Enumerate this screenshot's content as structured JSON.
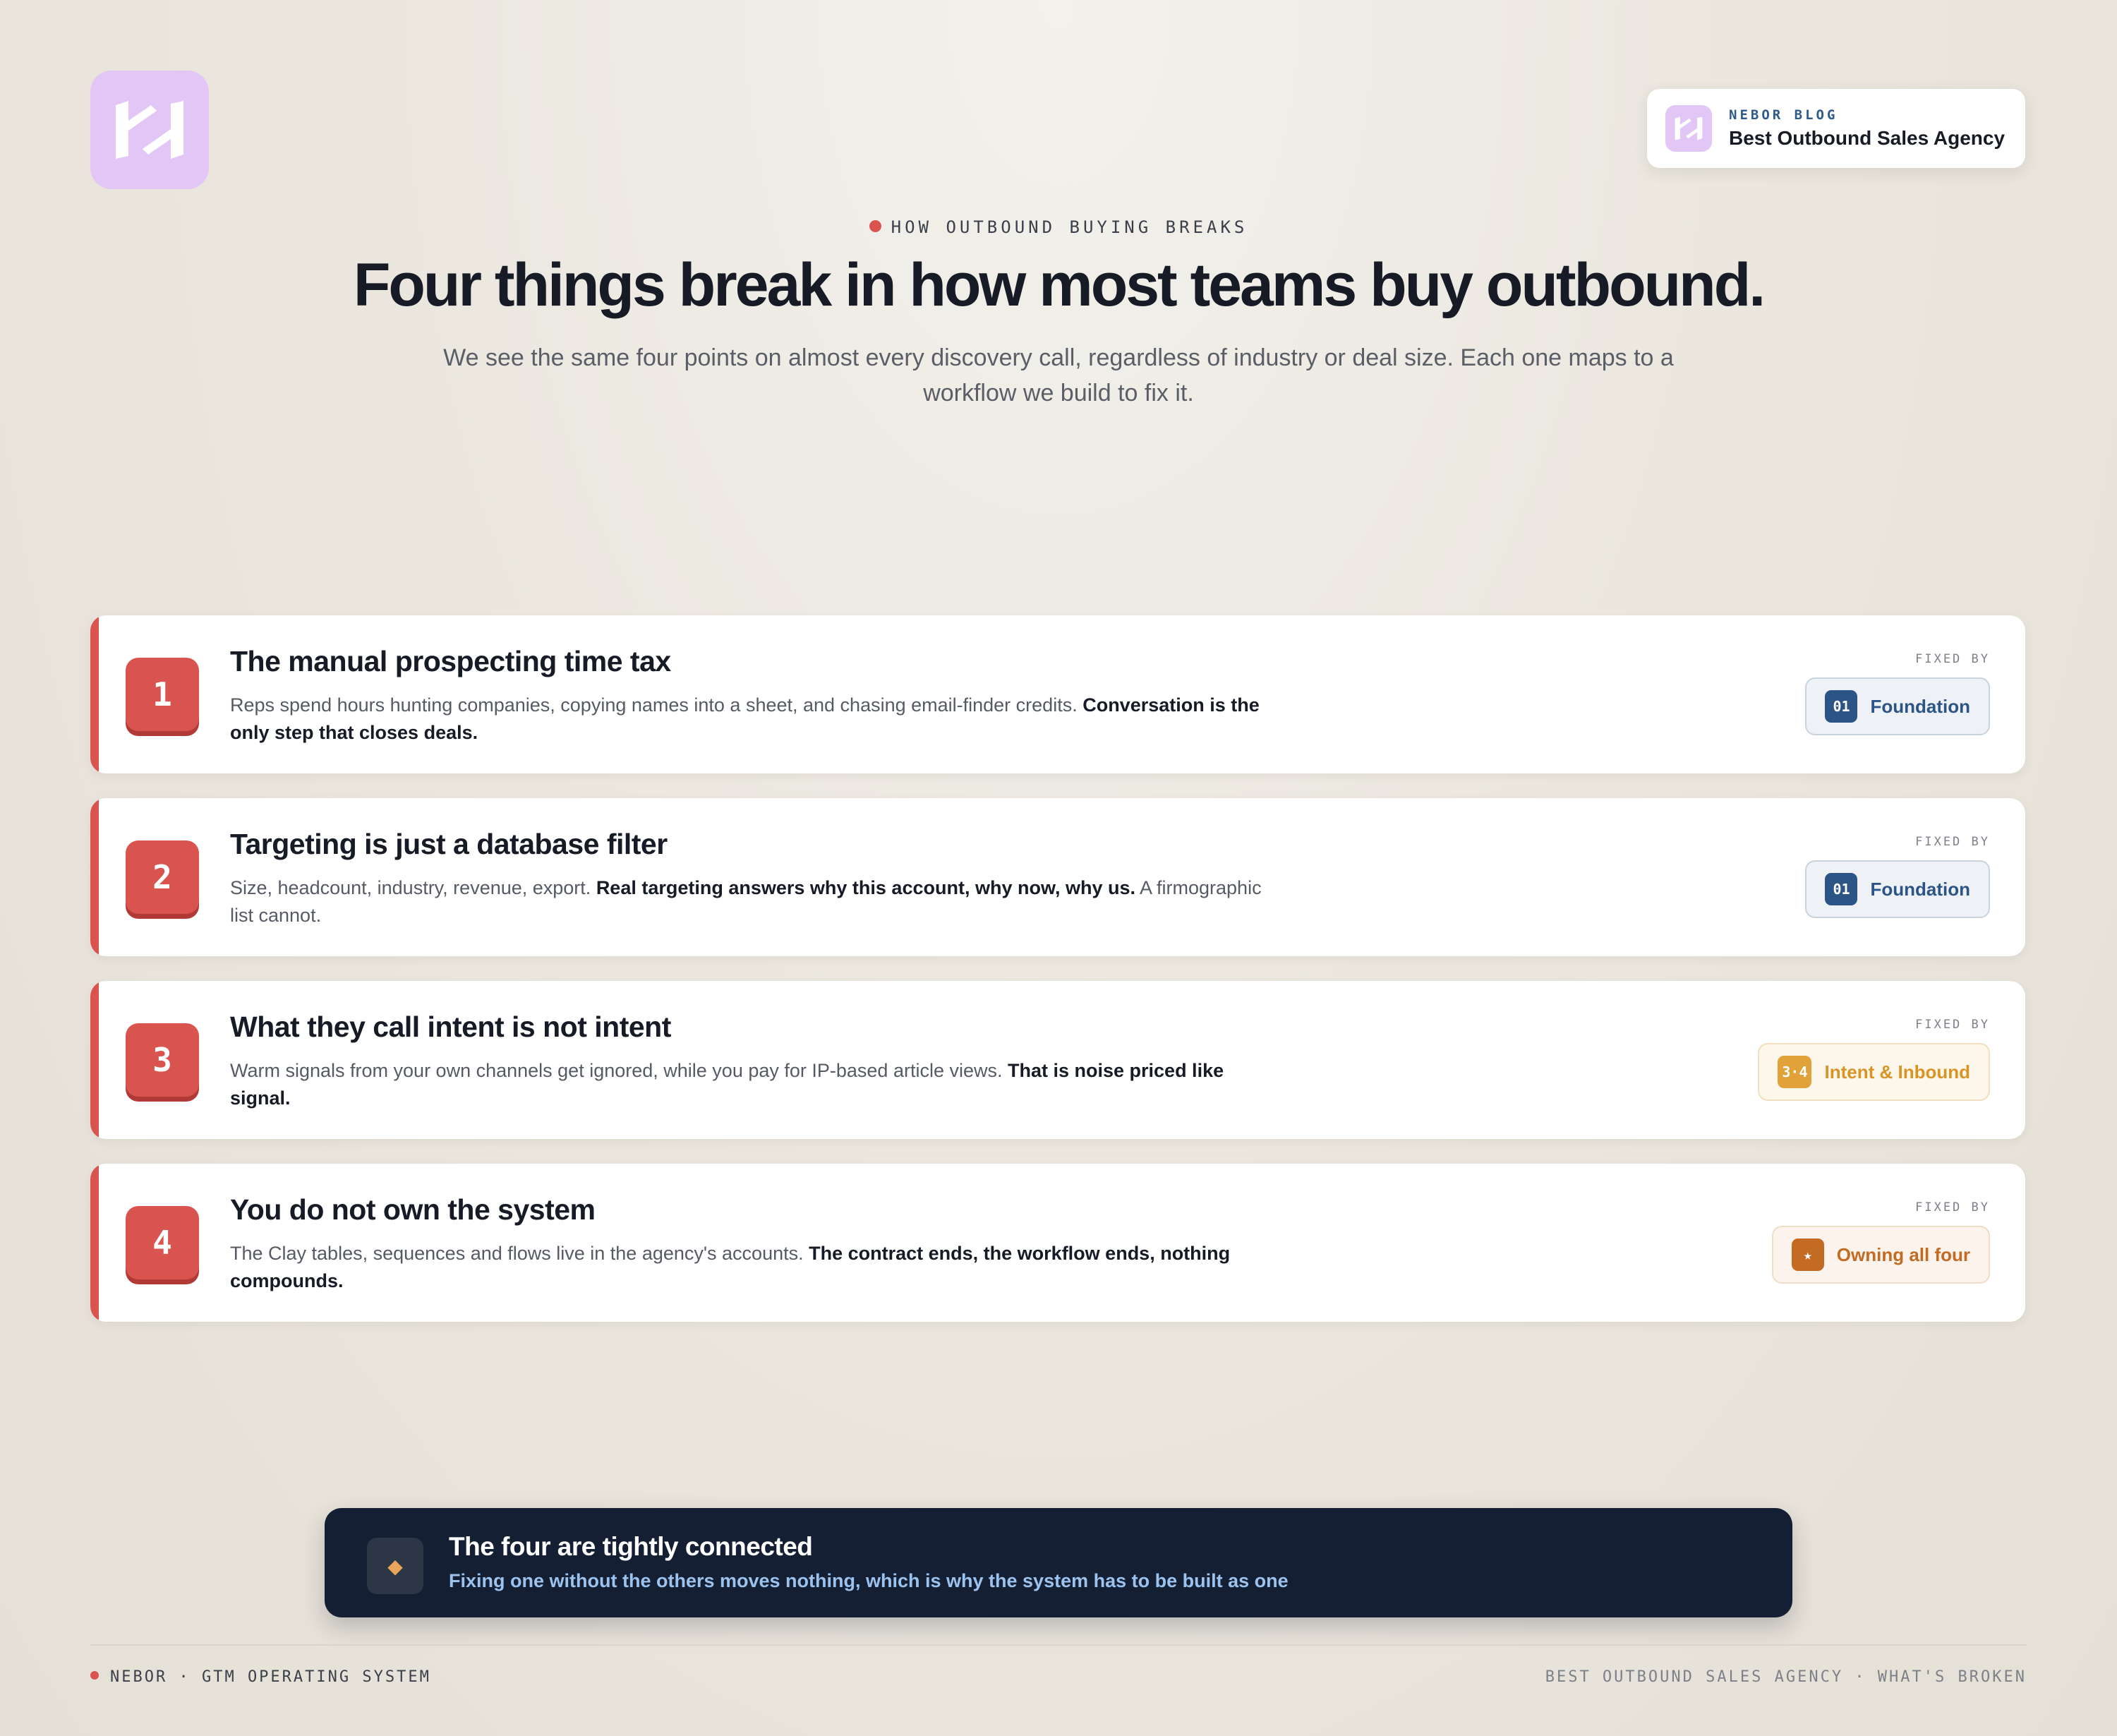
{
  "brand": {
    "logo_icon": "nebor-logo-icon",
    "accent_color": "#d9534f",
    "logo_bg": "#e1c6f6"
  },
  "blog_card": {
    "eyebrow": "NEBOR BLOG",
    "title": "Best Outbound Sales Agency"
  },
  "hero": {
    "eyebrow": "HOW OUTBOUND BUYING BREAKS",
    "headline": "Four things break in how most teams buy outbound.",
    "subhead": "We see the same four points on almost every discovery call, regardless of industry or deal size. Each one maps to a workflow we build to fix it."
  },
  "fixed_by_label": "FIXED BY",
  "problems": [
    {
      "number": "1",
      "title": "The manual prospecting time tax",
      "desc_plain": "Reps spend hours hunting companies, copying names into a sheet, and chasing email-finder credits. ",
      "desc_strong": "Conversation is the only step that closes deals.",
      "desc_tail": "",
      "fix_badge": "01",
      "fix_label": "Foundation",
      "fix_style": "blue"
    },
    {
      "number": "2",
      "title": "Targeting is just a database filter",
      "desc_plain": "Size, headcount, industry, revenue, export. ",
      "desc_strong": "Real targeting answers why this account, why now, why us.",
      "desc_tail": " A firmographic list cannot.",
      "fix_badge": "01",
      "fix_label": "Foundation",
      "fix_style": "blue"
    },
    {
      "number": "3",
      "title": "What they call intent is not intent",
      "desc_plain": "Warm signals from your own channels get ignored, while you pay for IP-based article views. ",
      "desc_strong": "That is noise priced like signal.",
      "desc_tail": "",
      "fix_badge": "3·4",
      "fix_label": "Intent & Inbound",
      "fix_style": "amber"
    },
    {
      "number": "4",
      "title": "You do not own the system",
      "desc_plain": "The Clay tables, sequences and flows live in the agency's accounts. ",
      "desc_strong": "The contract ends, the workflow ends, nothing compounds.",
      "desc_tail": "",
      "fix_badge": "★",
      "fix_label": "Owning all four",
      "fix_style": "orange"
    }
  ],
  "banner": {
    "icon": "diamond-icon",
    "icon_glyph": "◆",
    "title": "The four are tightly connected",
    "subtitle": "Fixing one without the others moves nothing, which is why the system has to be built as one"
  },
  "footer": {
    "left": "NEBOR · GTM OPERATING SYSTEM",
    "right": "BEST OUTBOUND SALES AGENCY · WHAT'S BROKEN"
  }
}
